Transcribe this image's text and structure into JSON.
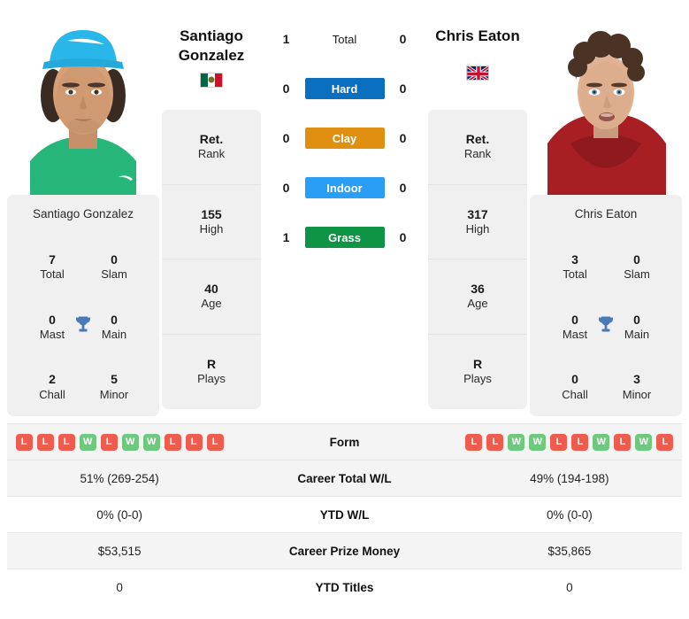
{
  "players": {
    "left": {
      "name_line1": "Santiago",
      "name_line2": "Gonzalez",
      "flag": "mexico-flag",
      "card": {
        "name": "Santiago Gonzalez",
        "total": "7",
        "total_label": "Total",
        "slam": "0",
        "slam_label": "Slam",
        "mast": "0",
        "mast_label": "Mast",
        "main": "0",
        "main_label": "Main",
        "chall": "2",
        "chall_label": "Chall",
        "minor": "5",
        "minor_label": "Minor",
        "trophy_icon": "trophy-icon"
      },
      "rank": {
        "rank_value": "Ret.",
        "rank_label": "Rank",
        "high_value": "155",
        "high_label": "High",
        "age_value": "40",
        "age_label": "Age",
        "plays_value": "R",
        "plays_label": "Plays"
      },
      "form": [
        "L",
        "L",
        "L",
        "W",
        "L",
        "W",
        "W",
        "L",
        "L",
        "L"
      ],
      "career_total_wl": "51% (269-254)",
      "ytd_wl": "0% (0-0)",
      "career_prize_money": "$53,515",
      "ytd_titles": "0"
    },
    "right": {
      "name_line1": "Chris Eaton",
      "name_line2": "",
      "flag": "united-kingdom-flag",
      "card": {
        "name": "Chris Eaton",
        "total": "3",
        "total_label": "Total",
        "slam": "0",
        "slam_label": "Slam",
        "mast": "0",
        "mast_label": "Mast",
        "main": "0",
        "main_label": "Main",
        "chall": "0",
        "chall_label": "Chall",
        "minor": "3",
        "minor_label": "Minor",
        "trophy_icon": "trophy-icon"
      },
      "rank": {
        "rank_value": "Ret.",
        "rank_label": "Rank",
        "high_value": "317",
        "high_label": "High",
        "age_value": "36",
        "age_label": "Age",
        "plays_value": "R",
        "plays_label": "Plays"
      },
      "form": [
        "L",
        "L",
        "W",
        "W",
        "L",
        "L",
        "W",
        "L",
        "W",
        "L"
      ],
      "career_total_wl": "49% (194-198)",
      "ytd_wl": "0% (0-0)",
      "career_prize_money": "$35,865",
      "ytd_titles": "0"
    }
  },
  "surfaces": [
    {
      "label": "Total",
      "left": "1",
      "right": "0",
      "color": "transparent",
      "plain": true
    },
    {
      "label": "Hard",
      "left": "0",
      "right": "0",
      "color": "#0b6fc0",
      "plain": false
    },
    {
      "label": "Clay",
      "left": "0",
      "right": "0",
      "color": "#e09010",
      "plain": false
    },
    {
      "label": "Indoor",
      "left": "0",
      "right": "0",
      "color": "#2a9df4",
      "plain": false
    },
    {
      "label": "Grass",
      "left": "1",
      "right": "0",
      "color": "#0e9444",
      "plain": false
    }
  ],
  "table_rows": [
    {
      "label": "Form"
    },
    {
      "label": "Career Total W/L",
      "left": "51% (269-254)",
      "right": "49% (194-198)"
    },
    {
      "label": "YTD W/L",
      "left": "0% (0-0)",
      "right": "0% (0-0)"
    },
    {
      "label": "Career Prize Money",
      "left": "$53,515",
      "right": "$35,865"
    },
    {
      "label": "YTD Titles",
      "left": "0",
      "right": "0"
    }
  ],
  "colors": {
    "win": "#6ec97e",
    "loss": "#ef5b4c",
    "trophy": "#4a7ab5",
    "card_bg": "#f0f0f0"
  }
}
